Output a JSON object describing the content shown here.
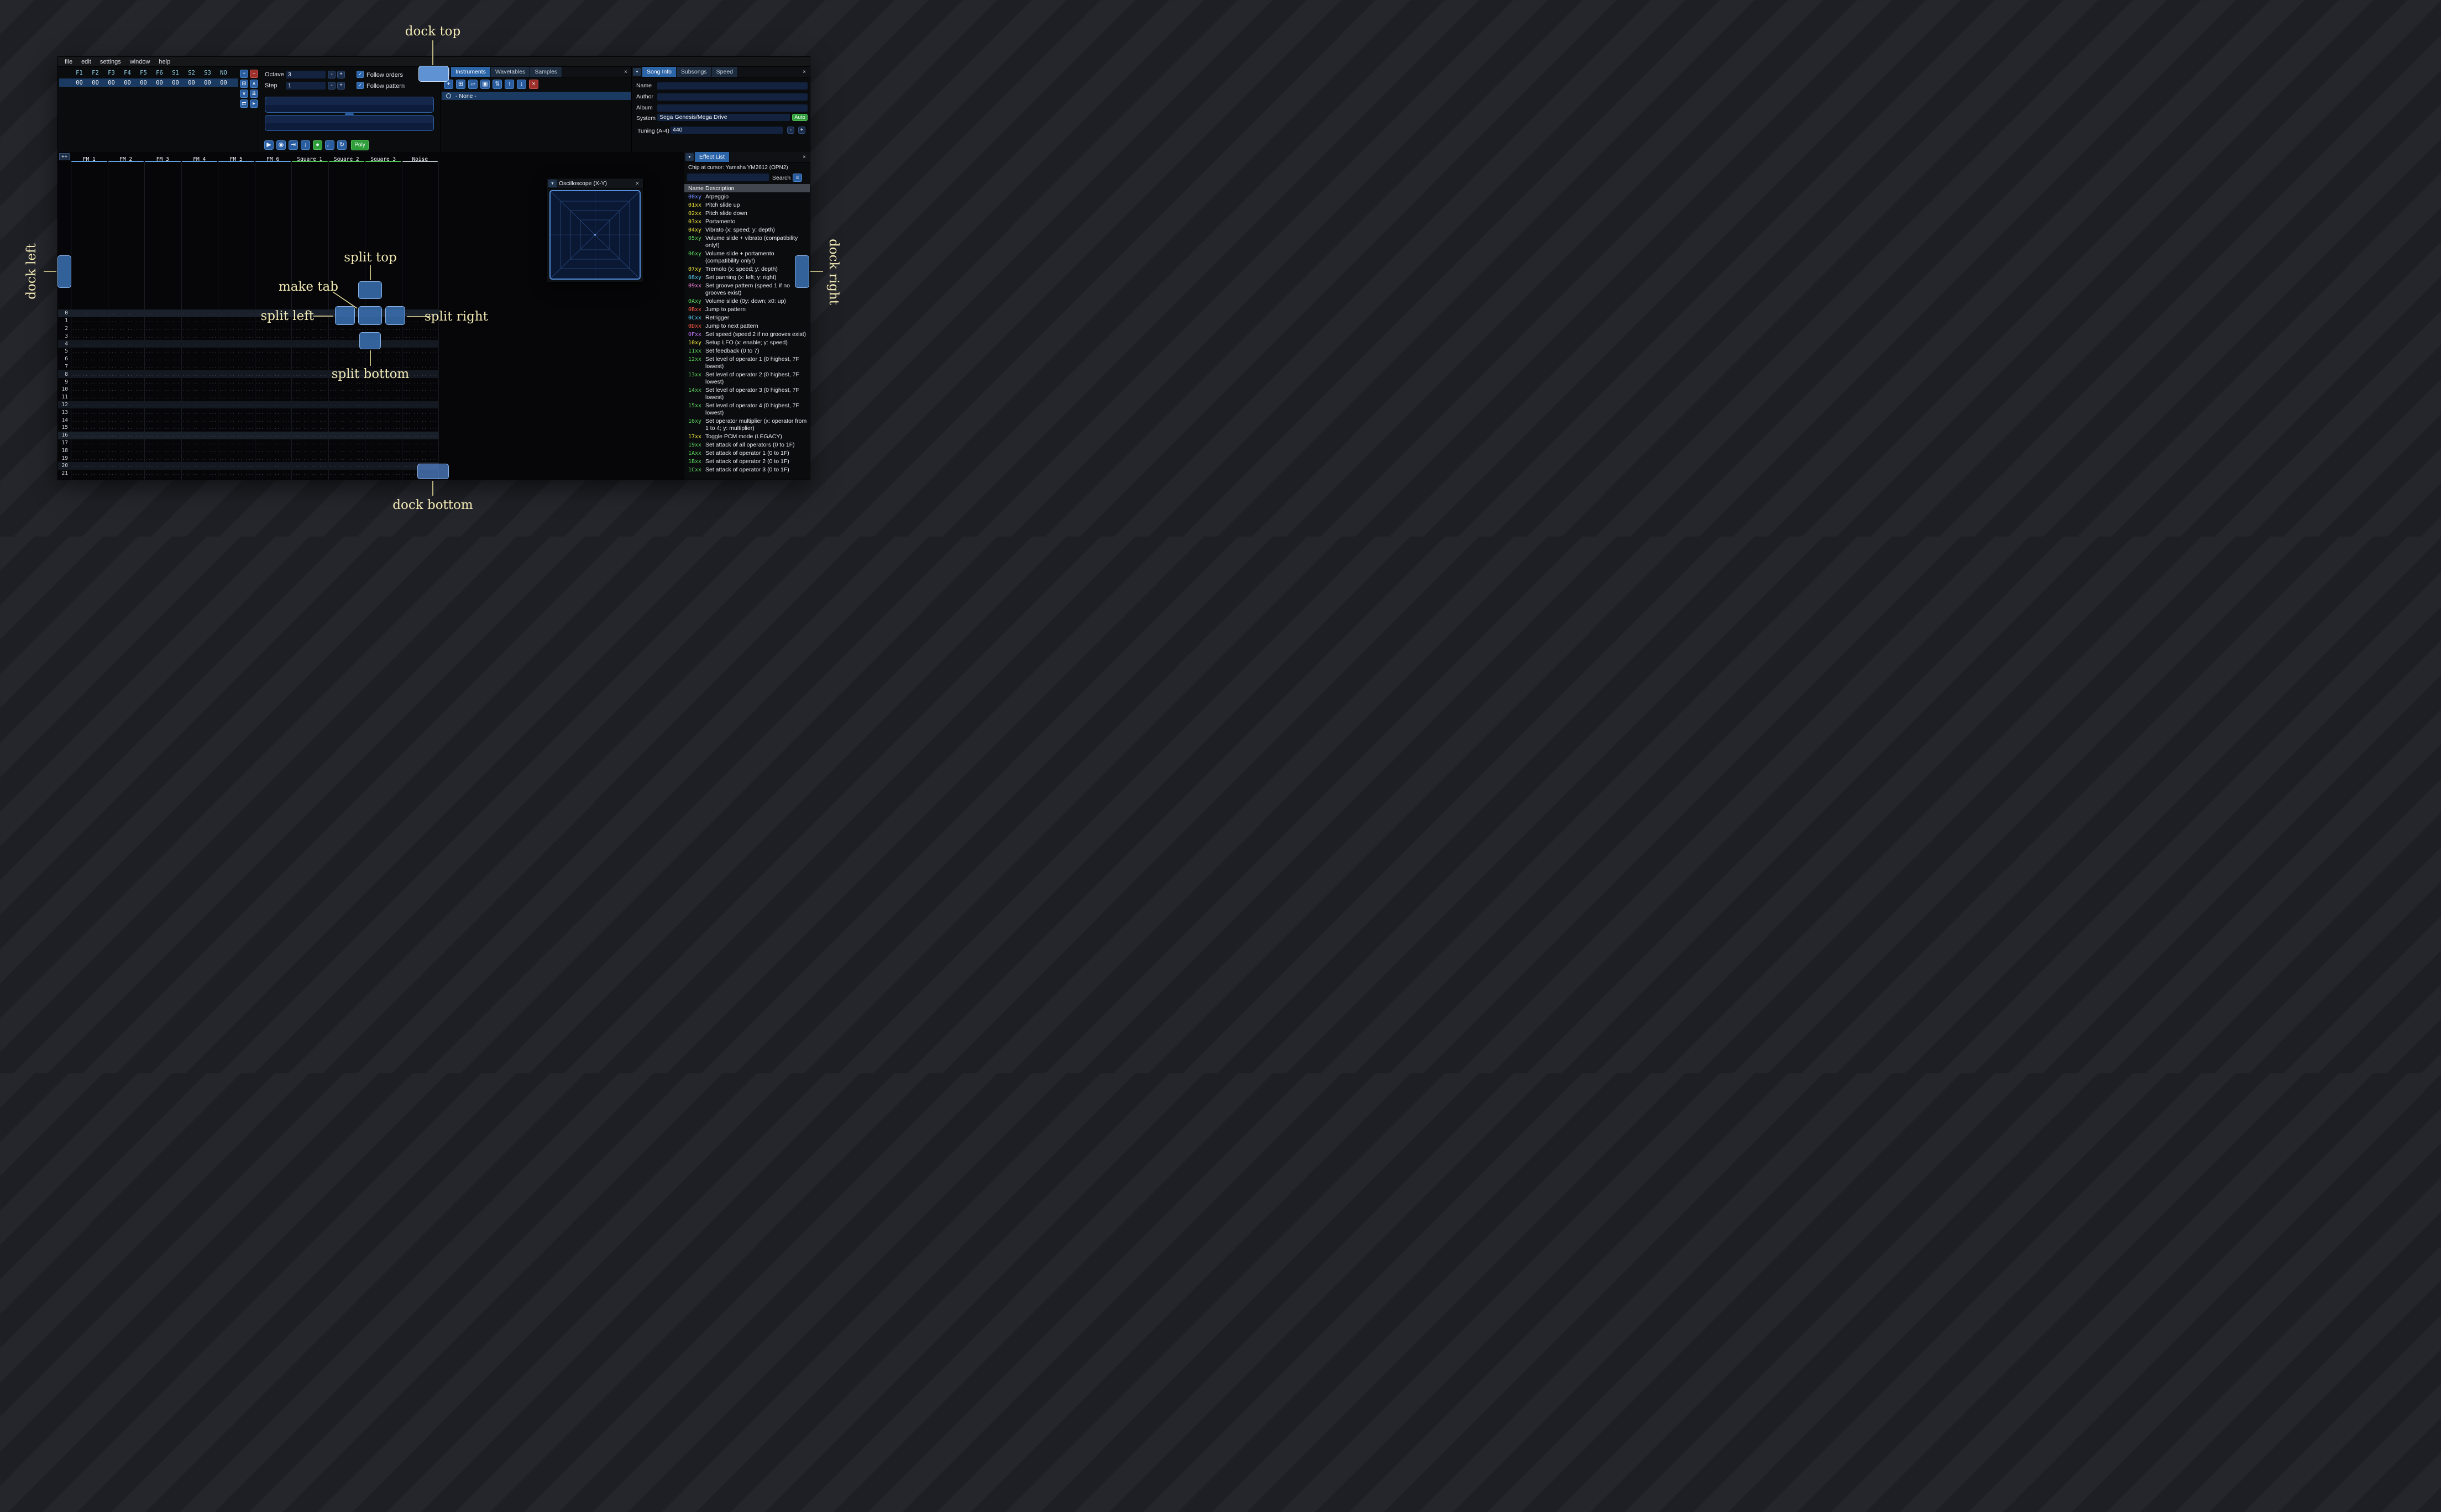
{
  "menu": {
    "items": [
      "file",
      "edit",
      "settings",
      "window",
      "help"
    ]
  },
  "icons": {
    "dropdown": "▼",
    "check": "✓",
    "menu": "≡"
  },
  "orders": {
    "channel_headers": [
      "F1",
      "F2",
      "F3",
      "F4",
      "F5",
      "F6",
      "S1",
      "S2",
      "S3",
      "NO"
    ],
    "row_values": [
      "00",
      "00",
      "00",
      "00",
      "00",
      "00",
      "00",
      "00",
      "00",
      "00"
    ],
    "toolbar": [
      {
        "name": "add-order",
        "icon": "+",
        "style": "blue"
      },
      {
        "name": "remove-order",
        "icon": "−",
        "style": "red"
      },
      {
        "name": "duplicate-order",
        "icon": "⊞",
        "style": "blue"
      },
      {
        "name": "move-order-up",
        "icon": "∧",
        "style": "blue"
      },
      {
        "name": "move-order-down",
        "icon": "∨",
        "style": "blue"
      },
      {
        "name": "duplicate-order-end",
        "icon": "⇊",
        "style": "blue"
      },
      {
        "name": "order-change-mode",
        "icon": "⇄",
        "style": "blue"
      },
      {
        "name": "order-edit-mode",
        "icon": "▸",
        "style": "blue"
      }
    ]
  },
  "controls": {
    "octave_label": "Octave",
    "octave_value": "3",
    "step_label": "Step",
    "step_value": "1",
    "minus": "-",
    "plus": "+",
    "follow_orders": "Follow orders",
    "follow_pattern": "Follow pattern",
    "transport": [
      {
        "name": "play",
        "icon": "▶",
        "style": "blue"
      },
      {
        "name": "play-pattern",
        "icon": "◉",
        "style": "blue"
      },
      {
        "name": "play-from-cursor",
        "icon": "⇥",
        "style": "blue"
      },
      {
        "name": "step-one-row",
        "icon": "↓",
        "style": "blue"
      },
      {
        "name": "record",
        "icon": "●",
        "style": "green"
      },
      {
        "name": "metronome",
        "icon": "♩",
        "style": "blue"
      },
      {
        "name": "repeat-pattern",
        "icon": "↻",
        "style": "blue"
      }
    ],
    "poly_label": "Poly"
  },
  "instruments": {
    "tabs": [
      "Instruments",
      "Wavetables",
      "Samples"
    ],
    "active_tab": "Instruments",
    "close": "×",
    "toolbar": [
      {
        "name": "add-instrument",
        "icon": "+",
        "style": "blue"
      },
      {
        "name": "duplicate-instrument",
        "icon": "⊞",
        "style": "blue"
      },
      {
        "name": "open-instrument",
        "icon": "▱",
        "style": "blue"
      },
      {
        "name": "save-instrument",
        "icon": "▣",
        "style": "blue"
      },
      {
        "name": "instrument-dir-view",
        "icon": "⇅",
        "style": "blue"
      },
      {
        "name": "move-instrument-up",
        "icon": "↑",
        "style": "blue"
      },
      {
        "name": "move-instrument-down",
        "icon": "↓",
        "style": "blue"
      },
      {
        "name": "delete-instrument",
        "icon": "×",
        "style": "red"
      }
    ],
    "list_item": "- None -"
  },
  "song_info": {
    "tabs": [
      "Song Info",
      "Subsongs",
      "Speed"
    ],
    "active_tab": "Song Info",
    "close": "×",
    "fields": [
      {
        "label": "Name",
        "value": ""
      },
      {
        "label": "Author",
        "value": ""
      },
      {
        "label": "Album",
        "value": ""
      }
    ],
    "system_label": "System",
    "system_value": "Sega Genesis/Mega Drive",
    "auto_label": "Auto",
    "tuning_label": "Tuning (A-4)",
    "tuning_value": "440",
    "minus": "-",
    "plus": "+"
  },
  "pattern": {
    "corner_label": "++",
    "channels": [
      {
        "name": "FM 1",
        "color": "#5e9fe0"
      },
      {
        "name": "FM 2",
        "color": "#5e9fe0"
      },
      {
        "name": "FM 3",
        "color": "#5e9fe0"
      },
      {
        "name": "FM 4",
        "color": "#5e9fe0"
      },
      {
        "name": "FM 5",
        "color": "#5e9fe0"
      },
      {
        "name": "FM 6",
        "color": "#5e9fe0"
      },
      {
        "name": "Square 1",
        "color": "#49c24f"
      },
      {
        "name": "Square 2",
        "color": "#49c24f"
      },
      {
        "name": "Square 3",
        "color": "#49c24f"
      },
      {
        "name": "Noise",
        "color": "#b9bfc7"
      }
    ],
    "row_count": 22,
    "empty_cell": "... .. .. ..."
  },
  "oscilloscope": {
    "title": "Oscilloscope (X-Y)",
    "close": "×"
  },
  "effect_list": {
    "title": "Effect List",
    "close": "×",
    "chip_line": "Chip at cursor: Yamaha YM2612 (OPN2)",
    "search_label": "Search",
    "search_value": "",
    "name_header": "Name",
    "description_header": "Description",
    "effects": [
      {
        "code": "00xy",
        "desc": "Arpeggio",
        "color": "#6d8aff"
      },
      {
        "code": "01xx",
        "desc": "Pitch slide up",
        "color": "#efe73c"
      },
      {
        "code": "02xx",
        "desc": "Pitch slide down",
        "color": "#efe73c"
      },
      {
        "code": "03xx",
        "desc": "Portamento",
        "color": "#efe73c"
      },
      {
        "code": "04xy",
        "desc": "Vibrato (x: speed; y: depth)",
        "color": "#efe73c"
      },
      {
        "code": "05xy",
        "desc": "Volume slide + vibrato (compatibility only!)",
        "color": "#59d65c"
      },
      {
        "code": "06xy",
        "desc": "Volume slide + portamento (compatibility only!)",
        "color": "#59d65c"
      },
      {
        "code": "07xy",
        "desc": "Tremolo (x: speed; y: depth)",
        "color": "#efe73c"
      },
      {
        "code": "08xy",
        "desc": "Set panning (x: left; y: right)",
        "color": "#53c7f0"
      },
      {
        "code": "09xx",
        "desc": "Set groove pattern (speed 1 if no grooves exist)",
        "color": "#f07fd9"
      },
      {
        "code": "0Axy",
        "desc": "Volume slide (0y: down; x0: up)",
        "color": "#59d65c"
      },
      {
        "code": "0Bxx",
        "desc": "Jump to pattern",
        "color": "#ff5947"
      },
      {
        "code": "0Cxx",
        "desc": "Retrigger",
        "color": "#53c7f0"
      },
      {
        "code": "0Dxx",
        "desc": "Jump to next pattern",
        "color": "#ff5947"
      },
      {
        "code": "0Fxx",
        "desc": "Set speed (speed 2 if no grooves exist)",
        "color": "#c478ff"
      },
      {
        "code": "10xy",
        "desc": "Setup LFO (x: enable; y: speed)",
        "color": "#efe73c"
      },
      {
        "code": "11xx",
        "desc": "Set feedback (0 to 7)",
        "color": "#59d65c"
      },
      {
        "code": "12xx",
        "desc": "Set level of operator 1 (0 highest, 7F lowest)",
        "color": "#59d65c"
      },
      {
        "code": "13xx",
        "desc": "Set level of operator 2 (0 highest, 7F lowest)",
        "color": "#59d65c"
      },
      {
        "code": "14xx",
        "desc": "Set level of operator 3 (0 highest, 7F lowest)",
        "color": "#59d65c"
      },
      {
        "code": "15xx",
        "desc": "Set level of operator 4 (0 highest, 7F lowest)",
        "color": "#59d65c"
      },
      {
        "code": "16xy",
        "desc": "Set operator multiplier (x: operator from 1 to 4; y: multiplier)",
        "color": "#59d65c"
      },
      {
        "code": "17xx",
        "desc": "Toggle PCM mode (LEGACY)",
        "color": "#efe73c"
      },
      {
        "code": "19xx",
        "desc": "Set attack of all operators (0 to 1F)",
        "color": "#59d65c"
      },
      {
        "code": "1Axx",
        "desc": "Set attack of operator 1 (0 to 1F)",
        "color": "#59d65c"
      },
      {
        "code": "1Bxx",
        "desc": "Set attack of operator 2 (0 to 1F)",
        "color": "#59d65c"
      },
      {
        "code": "1Cxx",
        "desc": "Set attack of operator 3 (0 to 1F)",
        "color": "#59d65c"
      }
    ]
  },
  "dock_overlay": {
    "accent": "#f2e9b4",
    "labels": {
      "dock_top": "dock top",
      "dock_bottom": "dock bottom",
      "dock_left": "dock left",
      "dock_right": "dock right",
      "split_top": "split top",
      "split_bottom": "split bottom",
      "split_left": "split left",
      "split_right": "split right",
      "make_tab": "make tab"
    }
  }
}
